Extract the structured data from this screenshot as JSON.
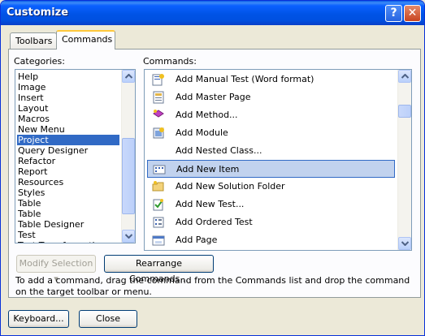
{
  "window": {
    "title": "Customize",
    "help_label": "?",
    "close_label": "✕"
  },
  "tabs": [
    {
      "label": "Toolbars"
    },
    {
      "label": "Commands"
    }
  ],
  "categories": {
    "label": "Categories:",
    "items": [
      "Help",
      "Image",
      "Insert",
      "Layout",
      "Macros",
      "New Menu",
      "Project",
      "Query Designer",
      "Refactor",
      "Report",
      "Resources",
      "Styles",
      "Table",
      "Table",
      "Table Designer",
      "Test",
      "Text Transformation"
    ],
    "selected": "Project"
  },
  "commands": {
    "label": "Commands:",
    "items": [
      {
        "label": "Add Manual Test (Word format)",
        "icon": "manual-test-icon"
      },
      {
        "label": "Add Master Page",
        "icon": "master-page-icon"
      },
      {
        "label": "Add Method...",
        "icon": "method-icon"
      },
      {
        "label": "Add Module",
        "icon": "module-icon"
      },
      {
        "label": "Add Nested Class...",
        "icon": ""
      },
      {
        "label": "Add New Item",
        "icon": "new-item-icon"
      },
      {
        "label": "Add New Solution Folder",
        "icon": "solution-folder-icon"
      },
      {
        "label": "Add New Test...",
        "icon": "new-test-icon"
      },
      {
        "label": "Add Ordered Test",
        "icon": "ordered-test-icon"
      },
      {
        "label": "Add Page",
        "icon": "page-icon"
      }
    ],
    "selected": "Add New Item"
  },
  "buttons": {
    "modify_selection": "Modify Selection",
    "rearrange": "Rearrange Commands...",
    "keyboard": "Keyboard...",
    "close": "Close"
  },
  "description": "To add a command, drag the command from the Commands list and drop the command on the target toolbar or menu."
}
